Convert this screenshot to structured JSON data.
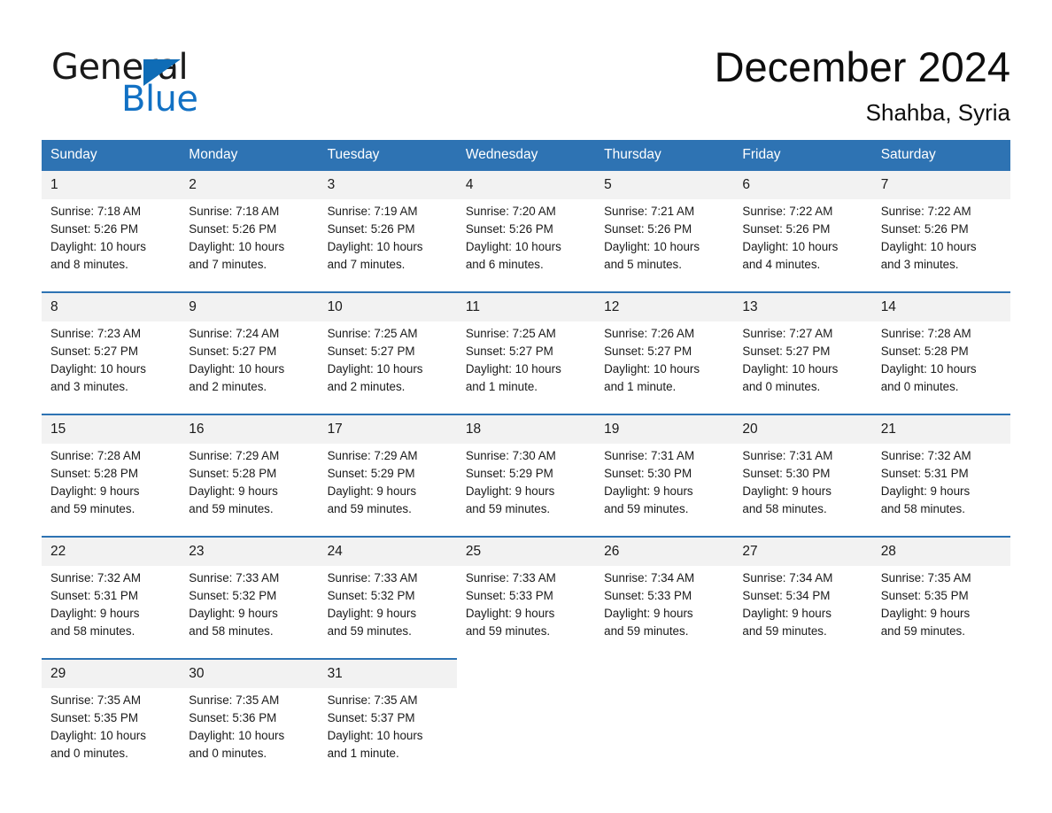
{
  "brand": {
    "name_part1": "General",
    "name_part2": "Blue",
    "accent_color": "#1271c4",
    "triangle_color": "#0f6cb6"
  },
  "header": {
    "title": "December 2024",
    "location": "Shahba, Syria"
  },
  "calendar": {
    "header_bg": "#2e73b3",
    "date_cell_bg": "#f2f2f2",
    "weekday_headers": [
      "Sunday",
      "Monday",
      "Tuesday",
      "Wednesday",
      "Thursday",
      "Friday",
      "Saturday"
    ],
    "weeks": [
      {
        "days": [
          {
            "date": "1",
            "sunrise": "Sunrise: 7:18 AM",
            "sunset": "Sunset: 5:26 PM",
            "daylight_line1": "Daylight: 10 hours",
            "daylight_line2": "and 8 minutes."
          },
          {
            "date": "2",
            "sunrise": "Sunrise: 7:18 AM",
            "sunset": "Sunset: 5:26 PM",
            "daylight_line1": "Daylight: 10 hours",
            "daylight_line2": "and 7 minutes."
          },
          {
            "date": "3",
            "sunrise": "Sunrise: 7:19 AM",
            "sunset": "Sunset: 5:26 PM",
            "daylight_line1": "Daylight: 10 hours",
            "daylight_line2": "and 7 minutes."
          },
          {
            "date": "4",
            "sunrise": "Sunrise: 7:20 AM",
            "sunset": "Sunset: 5:26 PM",
            "daylight_line1": "Daylight: 10 hours",
            "daylight_line2": "and 6 minutes."
          },
          {
            "date": "5",
            "sunrise": "Sunrise: 7:21 AM",
            "sunset": "Sunset: 5:26 PM",
            "daylight_line1": "Daylight: 10 hours",
            "daylight_line2": "and 5 minutes."
          },
          {
            "date": "6",
            "sunrise": "Sunrise: 7:22 AM",
            "sunset": "Sunset: 5:26 PM",
            "daylight_line1": "Daylight: 10 hours",
            "daylight_line2": "and 4 minutes."
          },
          {
            "date": "7",
            "sunrise": "Sunrise: 7:22 AM",
            "sunset": "Sunset: 5:26 PM",
            "daylight_line1": "Daylight: 10 hours",
            "daylight_line2": "and 3 minutes."
          }
        ]
      },
      {
        "days": [
          {
            "date": "8",
            "sunrise": "Sunrise: 7:23 AM",
            "sunset": "Sunset: 5:27 PM",
            "daylight_line1": "Daylight: 10 hours",
            "daylight_line2": "and 3 minutes."
          },
          {
            "date": "9",
            "sunrise": "Sunrise: 7:24 AM",
            "sunset": "Sunset: 5:27 PM",
            "daylight_line1": "Daylight: 10 hours",
            "daylight_line2": "and 2 minutes."
          },
          {
            "date": "10",
            "sunrise": "Sunrise: 7:25 AM",
            "sunset": "Sunset: 5:27 PM",
            "daylight_line1": "Daylight: 10 hours",
            "daylight_line2": "and 2 minutes."
          },
          {
            "date": "11",
            "sunrise": "Sunrise: 7:25 AM",
            "sunset": "Sunset: 5:27 PM",
            "daylight_line1": "Daylight: 10 hours",
            "daylight_line2": "and 1 minute."
          },
          {
            "date": "12",
            "sunrise": "Sunrise: 7:26 AM",
            "sunset": "Sunset: 5:27 PM",
            "daylight_line1": "Daylight: 10 hours",
            "daylight_line2": "and 1 minute."
          },
          {
            "date": "13",
            "sunrise": "Sunrise: 7:27 AM",
            "sunset": "Sunset: 5:27 PM",
            "daylight_line1": "Daylight: 10 hours",
            "daylight_line2": "and 0 minutes."
          },
          {
            "date": "14",
            "sunrise": "Sunrise: 7:28 AM",
            "sunset": "Sunset: 5:28 PM",
            "daylight_line1": "Daylight: 10 hours",
            "daylight_line2": "and 0 minutes."
          }
        ]
      },
      {
        "days": [
          {
            "date": "15",
            "sunrise": "Sunrise: 7:28 AM",
            "sunset": "Sunset: 5:28 PM",
            "daylight_line1": "Daylight: 9 hours",
            "daylight_line2": "and 59 minutes."
          },
          {
            "date": "16",
            "sunrise": "Sunrise: 7:29 AM",
            "sunset": "Sunset: 5:28 PM",
            "daylight_line1": "Daylight: 9 hours",
            "daylight_line2": "and 59 minutes."
          },
          {
            "date": "17",
            "sunrise": "Sunrise: 7:29 AM",
            "sunset": "Sunset: 5:29 PM",
            "daylight_line1": "Daylight: 9 hours",
            "daylight_line2": "and 59 minutes."
          },
          {
            "date": "18",
            "sunrise": "Sunrise: 7:30 AM",
            "sunset": "Sunset: 5:29 PM",
            "daylight_line1": "Daylight: 9 hours",
            "daylight_line2": "and 59 minutes."
          },
          {
            "date": "19",
            "sunrise": "Sunrise: 7:31 AM",
            "sunset": "Sunset: 5:30 PM",
            "daylight_line1": "Daylight: 9 hours",
            "daylight_line2": "and 59 minutes."
          },
          {
            "date": "20",
            "sunrise": "Sunrise: 7:31 AM",
            "sunset": "Sunset: 5:30 PM",
            "daylight_line1": "Daylight: 9 hours",
            "daylight_line2": "and 58 minutes."
          },
          {
            "date": "21",
            "sunrise": "Sunrise: 7:32 AM",
            "sunset": "Sunset: 5:31 PM",
            "daylight_line1": "Daylight: 9 hours",
            "daylight_line2": "and 58 minutes."
          }
        ]
      },
      {
        "days": [
          {
            "date": "22",
            "sunrise": "Sunrise: 7:32 AM",
            "sunset": "Sunset: 5:31 PM",
            "daylight_line1": "Daylight: 9 hours",
            "daylight_line2": "and 58 minutes."
          },
          {
            "date": "23",
            "sunrise": "Sunrise: 7:33 AM",
            "sunset": "Sunset: 5:32 PM",
            "daylight_line1": "Daylight: 9 hours",
            "daylight_line2": "and 58 minutes."
          },
          {
            "date": "24",
            "sunrise": "Sunrise: 7:33 AM",
            "sunset": "Sunset: 5:32 PM",
            "daylight_line1": "Daylight: 9 hours",
            "daylight_line2": "and 59 minutes."
          },
          {
            "date": "25",
            "sunrise": "Sunrise: 7:33 AM",
            "sunset": "Sunset: 5:33 PM",
            "daylight_line1": "Daylight: 9 hours",
            "daylight_line2": "and 59 minutes."
          },
          {
            "date": "26",
            "sunrise": "Sunrise: 7:34 AM",
            "sunset": "Sunset: 5:33 PM",
            "daylight_line1": "Daylight: 9 hours",
            "daylight_line2": "and 59 minutes."
          },
          {
            "date": "27",
            "sunrise": "Sunrise: 7:34 AM",
            "sunset": "Sunset: 5:34 PM",
            "daylight_line1": "Daylight: 9 hours",
            "daylight_line2": "and 59 minutes."
          },
          {
            "date": "28",
            "sunrise": "Sunrise: 7:35 AM",
            "sunset": "Sunset: 5:35 PM",
            "daylight_line1": "Daylight: 9 hours",
            "daylight_line2": "and 59 minutes."
          }
        ]
      },
      {
        "days": [
          {
            "date": "29",
            "sunrise": "Sunrise: 7:35 AM",
            "sunset": "Sunset: 5:35 PM",
            "daylight_line1": "Daylight: 10 hours",
            "daylight_line2": "and 0 minutes."
          },
          {
            "date": "30",
            "sunrise": "Sunrise: 7:35 AM",
            "sunset": "Sunset: 5:36 PM",
            "daylight_line1": "Daylight: 10 hours",
            "daylight_line2": "and 0 minutes."
          },
          {
            "date": "31",
            "sunrise": "Sunrise: 7:35 AM",
            "sunset": "Sunset: 5:37 PM",
            "daylight_line1": "Daylight: 10 hours",
            "daylight_line2": "and 1 minute."
          },
          {
            "date": "",
            "sunrise": "",
            "sunset": "",
            "daylight_line1": "",
            "daylight_line2": ""
          },
          {
            "date": "",
            "sunrise": "",
            "sunset": "",
            "daylight_line1": "",
            "daylight_line2": ""
          },
          {
            "date": "",
            "sunrise": "",
            "sunset": "",
            "daylight_line1": "",
            "daylight_line2": ""
          },
          {
            "date": "",
            "sunrise": "",
            "sunset": "",
            "daylight_line1": "",
            "daylight_line2": ""
          }
        ]
      }
    ]
  }
}
